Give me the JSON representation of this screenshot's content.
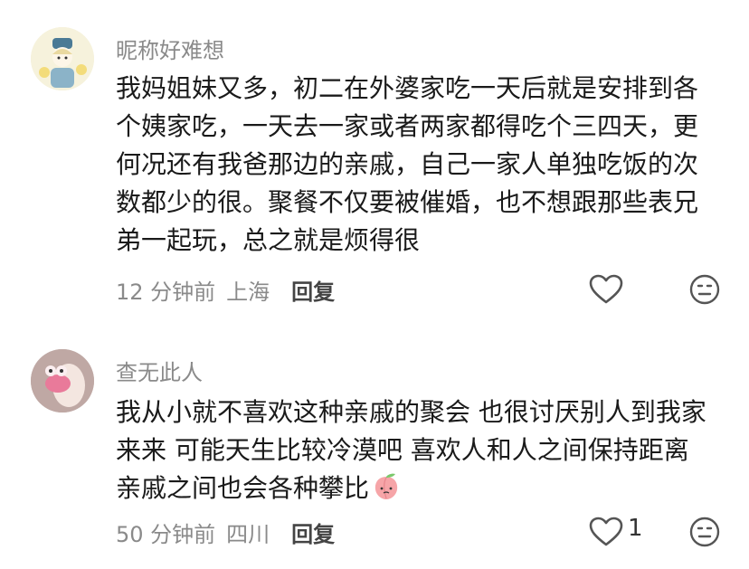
{
  "comments": [
    {
      "username": "昵称好难想",
      "text": "我妈姐妹又多，初二在外婆家吃一天后就是安排到各个姨家吃，一天去一家或者两家都得吃个三四天，更何况还有我爸那边的亲戚，自己一家人单独吃饭的次数都少的很。聚餐不仅要被催婚，也不想跟那些表兄弟一起玩，总之就是烦得很",
      "time": "12 分钟前",
      "location": "上海",
      "reply_label": "回复",
      "like_count": ""
    },
    {
      "username": "查无此人",
      "text": "我从小就不喜欢这种亲戚的聚会 也很讨厌别人到我家来来 可能天生比较冷漠吧 喜欢人和人之间保持距离 亲戚之间也会各种攀比",
      "time": "50 分钟前",
      "location": "四川",
      "reply_label": "回复",
      "like_count": "1"
    }
  ],
  "icons": {
    "like": "heart-outline-icon",
    "dislike": "meh-face-icon",
    "emoji": "peach-emoji"
  },
  "colors": {
    "text": "#1a1a1a",
    "secondary": "#8a8a8a",
    "icon": "#555555"
  }
}
